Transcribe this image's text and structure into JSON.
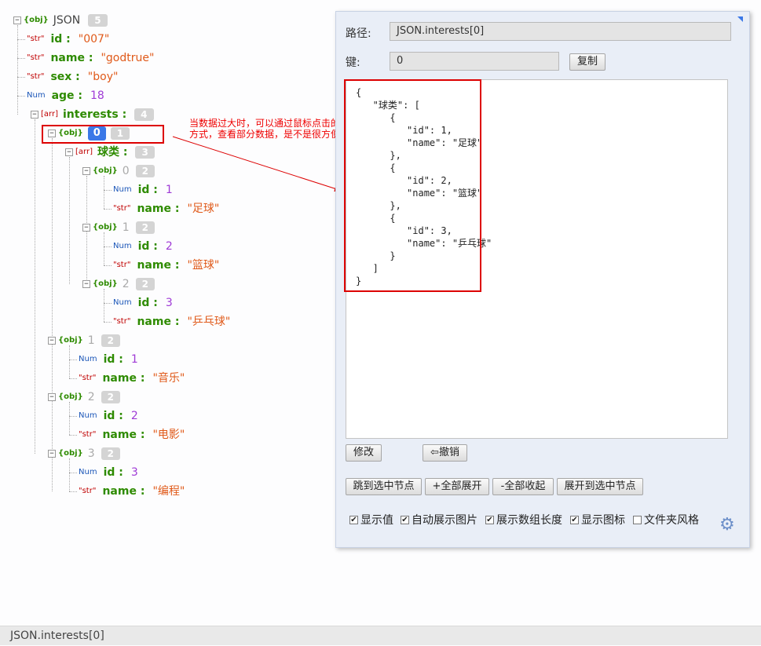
{
  "tree": {
    "root": {
      "type": "{obj}",
      "name": "JSON",
      "count": "5"
    },
    "fields": [
      {
        "type": "\"str\"",
        "key": "id :",
        "value": "\"007\""
      },
      {
        "type": "\"str\"",
        "key": "name :",
        "value": "\"godtrue\""
      },
      {
        "type": "\"str\"",
        "key": "sex :",
        "value": "\"boy\""
      },
      {
        "type": "Num",
        "key": "age :",
        "value": "18"
      }
    ],
    "interests": {
      "type": "[arr]",
      "key": "interests :",
      "count": "4"
    },
    "item0": {
      "type": "{obj}",
      "index": "0",
      "count": "1"
    },
    "balls": {
      "type": "[arr]",
      "key": "球类 :",
      "count": "3"
    },
    "ball_items": [
      {
        "type": "{obj}",
        "index": "0",
        "count": "2",
        "id_type": "Num",
        "id_key": "id :",
        "id_value": "1",
        "name_type": "\"str\"",
        "name_key": "name :",
        "name_value": "\"足球\""
      },
      {
        "type": "{obj}",
        "index": "1",
        "count": "2",
        "id_type": "Num",
        "id_key": "id :",
        "id_value": "2",
        "name_type": "\"str\"",
        "name_key": "name :",
        "name_value": "\"篮球\""
      },
      {
        "type": "{obj}",
        "index": "2",
        "count": "2",
        "id_type": "Num",
        "id_key": "id :",
        "id_value": "3",
        "name_type": "\"str\"",
        "name_key": "name :",
        "name_value": "\"乒乓球\""
      }
    ],
    "interest_items": [
      {
        "type": "{obj}",
        "index": "1",
        "count": "2",
        "id_type": "Num",
        "id_key": "id :",
        "id_value": "1",
        "name_type": "\"str\"",
        "name_key": "name :",
        "name_value": "\"音乐\""
      },
      {
        "type": "{obj}",
        "index": "2",
        "count": "2",
        "id_type": "Num",
        "id_key": "id :",
        "id_value": "2",
        "name_type": "\"str\"",
        "name_key": "name :",
        "name_value": "\"电影\""
      },
      {
        "type": "{obj}",
        "index": "3",
        "count": "2",
        "id_type": "Num",
        "id_key": "id :",
        "id_value": "3",
        "name_type": "\"str\"",
        "name_key": "name :",
        "name_value": "\"编程\""
      }
    ]
  },
  "annotation": {
    "line1": "当数据过大时，可以通过鼠标点击的",
    "line2": "方式，查看部分数据，是不是很方便。"
  },
  "panel": {
    "path_label": "路径:",
    "path_value": "JSON.interests[0]",
    "key_label": "键:",
    "key_value": "0",
    "copy_button": "复制",
    "json_text": "{\n   \"球类\": [\n      {\n         \"id\": 1,\n         \"name\": \"足球\"\n      },\n      {\n         \"id\": 2,\n         \"name\": \"篮球\"\n      },\n      {\n         \"id\": 3,\n         \"name\": \"乒乓球\"\n      }\n   ]\n}",
    "edit_button": "修改",
    "undo_button": "⇦撤销",
    "jump_button": "跳到选中节点",
    "expand_all_button": "+全部展开",
    "collapse_all_button": "-全部收起",
    "expand_to_button": "展开到选中节点",
    "checkboxes": [
      {
        "label": "显示值",
        "checked": true
      },
      {
        "label": "自动展示图片",
        "checked": true
      },
      {
        "label": "展示数组长度",
        "checked": true
      },
      {
        "label": "显示图标",
        "checked": true
      },
      {
        "label": "文件夹风格",
        "checked": false
      }
    ],
    "gear_icon": "gear-icon"
  },
  "status_bar": "JSON.interests[0]",
  "colors": {
    "annotation": "#dd0000",
    "selected": "#3b78e7",
    "key": "#2e8b00",
    "string": "#e05a1a",
    "number": "#9f3bd6"
  }
}
